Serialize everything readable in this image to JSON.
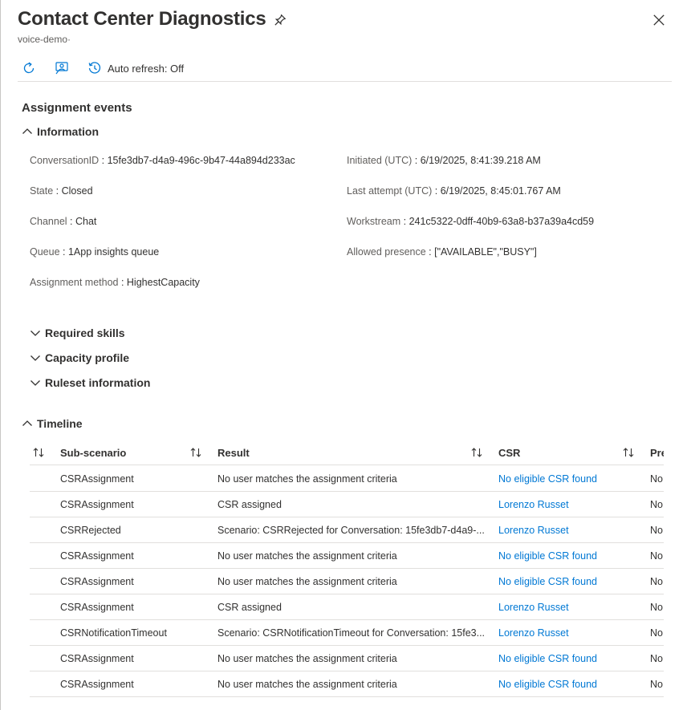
{
  "header": {
    "title": "Contact Center Diagnostics",
    "subtitle": "voice-demo·"
  },
  "toolbar": {
    "auto_refresh_label": "Auto refresh: Off"
  },
  "section": {
    "title": "Assignment events"
  },
  "information": {
    "label": "Information",
    "left": [
      {
        "key": "ConversationID",
        "value": "15fe3db7-d4a9-496c-9b47-44a894d233ac"
      },
      {
        "key": "State",
        "value": "Closed"
      },
      {
        "key": "Channel",
        "value": "Chat"
      },
      {
        "key": "Queue",
        "value": "1App insights queue"
      },
      {
        "key": "Assignment method",
        "value": "HighestCapacity"
      }
    ],
    "right": [
      {
        "key": "Initiated (UTC)",
        "value": "6/19/2025, 8:41:39.218 AM"
      },
      {
        "key": "Last attempt (UTC)",
        "value": "6/19/2025, 8:45:01.767 AM"
      },
      {
        "key": "Workstream",
        "value": "241c5322-0dff-40b9-63a8-b37a39a4cd59"
      },
      {
        "key": "Allowed presence",
        "value": "[\"AVAILABLE\",\"BUSY\"]"
      }
    ]
  },
  "collapsed_groups": [
    {
      "label": "Required skills"
    },
    {
      "label": "Capacity profile"
    },
    {
      "label": "Ruleset information"
    }
  ],
  "timeline": {
    "label": "Timeline",
    "columns": {
      "sub_scenario": "Sub-scenario",
      "result": "Result",
      "csr": "CSR",
      "pre": "Pre"
    },
    "rows": [
      {
        "sub": "CSRAssignment",
        "result": "No user matches the assignment criteria",
        "csr": "No eligible CSR found",
        "pre": "No"
      },
      {
        "sub": "CSRAssignment",
        "result": "CSR assigned",
        "csr": "Lorenzo Russet",
        "pre": "No"
      },
      {
        "sub": "CSRRejected",
        "result": "Scenario: CSRRejected for Conversation: 15fe3db7-d4a9-...",
        "csr": "Lorenzo Russet",
        "pre": "No"
      },
      {
        "sub": "CSRAssignment",
        "result": "No user matches the assignment criteria",
        "csr": "No eligible CSR found",
        "pre": "No"
      },
      {
        "sub": "CSRAssignment",
        "result": "No user matches the assignment criteria",
        "csr": "No eligible CSR found",
        "pre": "No"
      },
      {
        "sub": "CSRAssignment",
        "result": "CSR assigned",
        "csr": "Lorenzo Russet",
        "pre": "No"
      },
      {
        "sub": "CSRNotificationTimeout",
        "result": "Scenario: CSRNotificationTimeout for Conversation: 15fe3...",
        "csr": "Lorenzo Russet",
        "pre": "No"
      },
      {
        "sub": "CSRAssignment",
        "result": "No user matches the assignment criteria",
        "csr": "No eligible CSR found",
        "pre": "No"
      },
      {
        "sub": "CSRAssignment",
        "result": "No user matches the assignment criteria",
        "csr": "No eligible CSR found",
        "pre": "No"
      }
    ]
  },
  "colors": {
    "text": "#323130",
    "muted": "#605e5c",
    "link": "#0078d4",
    "divider": "#e1dfdd"
  }
}
